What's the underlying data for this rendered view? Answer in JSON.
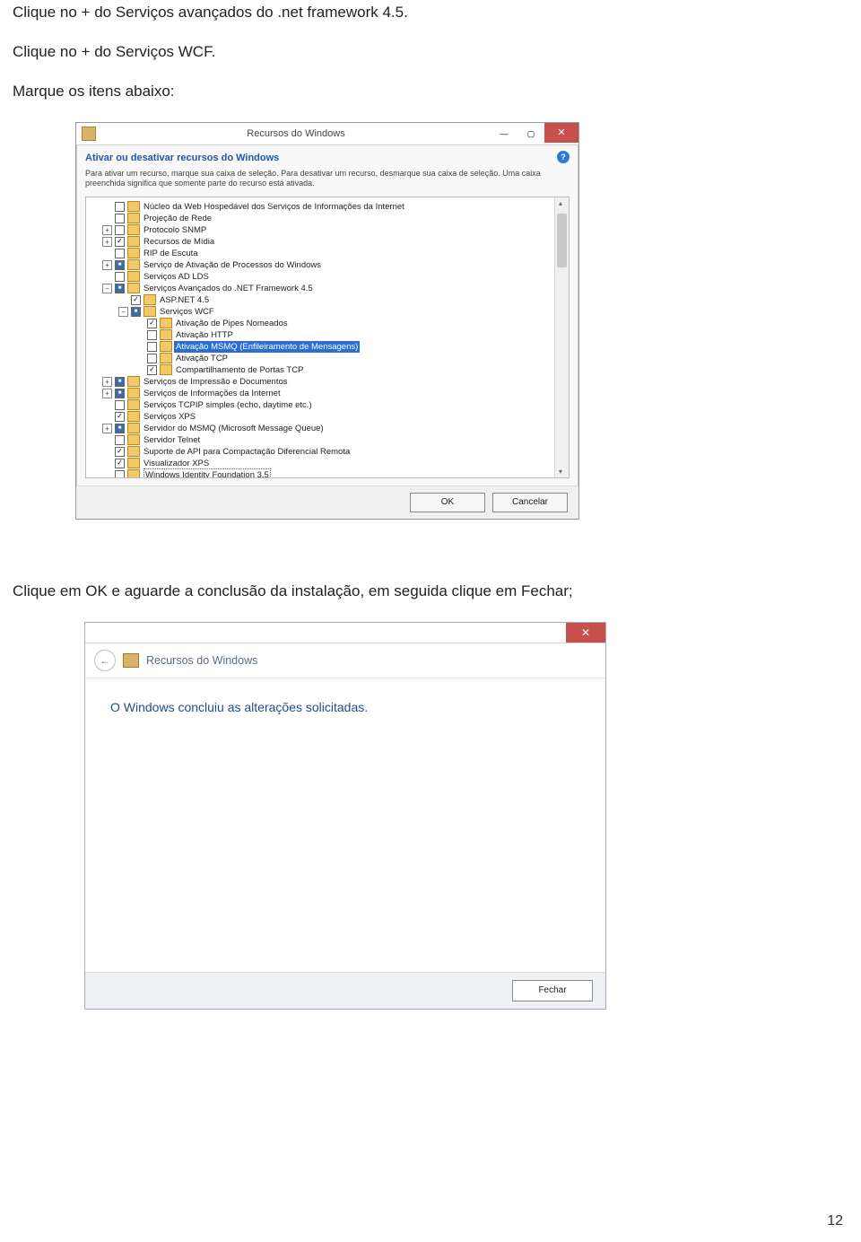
{
  "doc": {
    "line1": "Clique no + do Serviços avançados do .net framework 4.5.",
    "line2": "Clique no + do Serviços WCF.",
    "line3": "Marque os itens abaixo:",
    "line4": "Clique em OK e aguarde a conclusão da instalação, em seguida clique em Fechar;",
    "page_num": "12"
  },
  "dlg1": {
    "title": "Recursos do Windows",
    "header": "Ativar ou desativar recursos do Windows",
    "help": "?",
    "desc": "Para ativar um recurso, marque sua caixa de seleção. Para desativar um recurso, desmarque sua caixa de seleção. Uma caixa preenchida significa que somente parte do recurso está ativada.",
    "ok": "OK",
    "cancel": "Cancelar",
    "items": [
      {
        "indent": 0,
        "expander": "",
        "state": "",
        "label": "Núcleo da Web Hospedável dos Serviços de Informações da Internet"
      },
      {
        "indent": 0,
        "expander": "",
        "state": "",
        "label": "Projeção de Rede"
      },
      {
        "indent": 0,
        "expander": "+",
        "state": "",
        "label": "Protocolo SNMP"
      },
      {
        "indent": 0,
        "expander": "+",
        "state": "checked",
        "label": "Recursos de Mídia"
      },
      {
        "indent": 0,
        "expander": "",
        "state": "",
        "label": "RIP de Escuta"
      },
      {
        "indent": 0,
        "expander": "+",
        "state": "mixed",
        "label": "Serviço de Ativação de Processos do Windows"
      },
      {
        "indent": 0,
        "expander": "",
        "state": "",
        "label": "Serviços AD LDS"
      },
      {
        "indent": 0,
        "expander": "-",
        "state": "mixed",
        "label": "Serviços Avançados do .NET Framework 4.5"
      },
      {
        "indent": 1,
        "expander": "",
        "state": "checked",
        "label": "ASP.NET 4.5"
      },
      {
        "indent": 1,
        "expander": "-",
        "state": "mixed",
        "label": "Serviços WCF"
      },
      {
        "indent": 2,
        "expander": "",
        "state": "checked",
        "label": "Ativação de Pipes Nomeados"
      },
      {
        "indent": 2,
        "expander": "",
        "state": "",
        "label": "Ativação HTTP"
      },
      {
        "indent": 2,
        "expander": "",
        "state": "",
        "label": "Ativação MSMQ (Enfileiramento de Mensagens)",
        "highlight": true
      },
      {
        "indent": 2,
        "expander": "",
        "state": "",
        "label": "Ativação TCP"
      },
      {
        "indent": 2,
        "expander": "",
        "state": "checked",
        "label": "Compartilhamento de Portas TCP"
      },
      {
        "indent": 0,
        "expander": "+",
        "state": "mixed",
        "label": "Serviços de Impressão e Documentos"
      },
      {
        "indent": 0,
        "expander": "+",
        "state": "mixed",
        "label": "Serviços de Informações da Internet"
      },
      {
        "indent": 0,
        "expander": "",
        "state": "",
        "label": "Serviços TCPIP simples (echo, daytime etc.)"
      },
      {
        "indent": 0,
        "expander": "",
        "state": "checked",
        "label": "Serviços XPS"
      },
      {
        "indent": 0,
        "expander": "+",
        "state": "mixed",
        "label": "Servidor do MSMQ (Microsoft Message Queue)"
      },
      {
        "indent": 0,
        "expander": "",
        "state": "",
        "label": "Servidor Telnet"
      },
      {
        "indent": 0,
        "expander": "",
        "state": "checked",
        "label": "Suporte de API para Compactação Diferencial Remota"
      },
      {
        "indent": 0,
        "expander": "",
        "state": "checked",
        "label": "Visualizador XPS"
      },
      {
        "indent": 0,
        "expander": "",
        "state": "",
        "label": "Windows Identity Foundation 3.5",
        "dotted": true
      }
    ]
  },
  "dlg2": {
    "title": "Recursos do Windows",
    "message": "O Windows concluiu as alterações solicitadas.",
    "close_btn": "Fechar"
  }
}
